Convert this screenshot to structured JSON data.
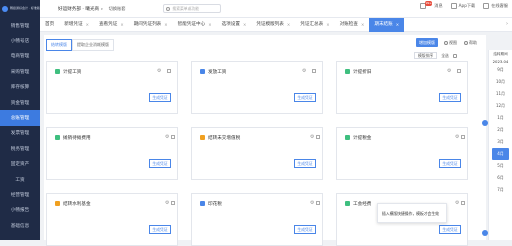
{
  "app": {
    "logo_text": "畅捷通好会计 · 标准版"
  },
  "sidebar": {
    "items": [
      {
        "label": "销售管理",
        "active": false
      },
      {
        "label": "小畅号店",
        "active": false
      },
      {
        "label": "电商管理",
        "active": false
      },
      {
        "label": "采购管理",
        "active": false
      },
      {
        "label": "库存核算",
        "active": false
      },
      {
        "label": "资金管理",
        "active": false
      },
      {
        "label": "总账管理",
        "active": true
      },
      {
        "label": "发票管理",
        "active": false
      },
      {
        "label": "税务管理",
        "active": false
      },
      {
        "label": "固定资产",
        "active": false
      },
      {
        "label": "工资",
        "active": false
      },
      {
        "label": "经营管理",
        "active": false
      },
      {
        "label": "小畅报告",
        "active": false
      },
      {
        "label": "基础信息",
        "active": false
      }
    ]
  },
  "topbar": {
    "company": "好运财务部 · 曦光商",
    "switch_label": "切换账套",
    "search_placeholder": "搜索菜单或功能",
    "message_label": "消息",
    "message_count": "99+",
    "app_label": "App下载",
    "online_label": "在线客服"
  },
  "tabs": [
    {
      "label": "首页",
      "closable": false,
      "active": false
    },
    {
      "label": "新增凭证",
      "closable": true,
      "active": false
    },
    {
      "label": "查看凭证",
      "closable": true,
      "active": false
    },
    {
      "label": "期间凭证列表",
      "closable": true,
      "active": false
    },
    {
      "label": "智能凭证中心",
      "closable": true,
      "active": false
    },
    {
      "label": "选项设置",
      "closable": true,
      "active": false
    },
    {
      "label": "凭证模版列表",
      "closable": true,
      "active": false
    },
    {
      "label": "凭证汇总表",
      "closable": true,
      "active": false
    },
    {
      "label": "对账检查",
      "closable": true,
      "active": false
    },
    {
      "label": "期末结账",
      "closable": true,
      "active": true
    }
  ],
  "subtabs": [
    "结转模版",
    "提取企业消耗模版"
  ],
  "actions": {
    "add_label": "增加模版",
    "view_label": "视图",
    "help_label": "帮助"
  },
  "toolbar": {
    "sort_label": "模版排序",
    "all_label": "全选"
  },
  "cards": [
    {
      "title": "计提工资",
      "color": "#3fbf7f",
      "button": "生成凭证",
      "checkbox": true
    },
    {
      "title": "发放工资",
      "color": "#4a86e8",
      "button": "生成凭证",
      "checkbox": true
    },
    {
      "title": "计提折旧",
      "color": "#3fbf7f",
      "button": "生成凭证",
      "checkbox": true
    },
    {
      "title": "摊销待摊费用",
      "color": "#3fbf7f",
      "button": "生成凭证",
      "checkbox": false
    },
    {
      "title": "结转未交增值税",
      "color": "#f0a020",
      "button": "生成凭证",
      "checkbox": false
    },
    {
      "title": "计提税金",
      "color": "#3fbf7f",
      "button": "生成凭证",
      "checkbox": false
    },
    {
      "title": "结转水利基金",
      "color": "#f0a020",
      "button": "生成凭证",
      "checkbox": false
    },
    {
      "title": "印花税",
      "color": "#4a86e8",
      "button": "生成凭证",
      "checkbox": false
    },
    {
      "title": "工会经费",
      "color": "#3fbf7f",
      "button": "生成凭证",
      "checkbox": false
    }
  ],
  "tooltip": {
    "text": "插入模版快捷操作，模板才会生效"
  },
  "calendar": {
    "header": "结转期间",
    "year": "2023.04",
    "months": [
      "9月",
      "10月",
      "11月",
      "12月",
      "1月",
      "2月",
      "3月",
      "4月",
      "5月",
      "6月",
      "7月"
    ],
    "active": "4月"
  }
}
